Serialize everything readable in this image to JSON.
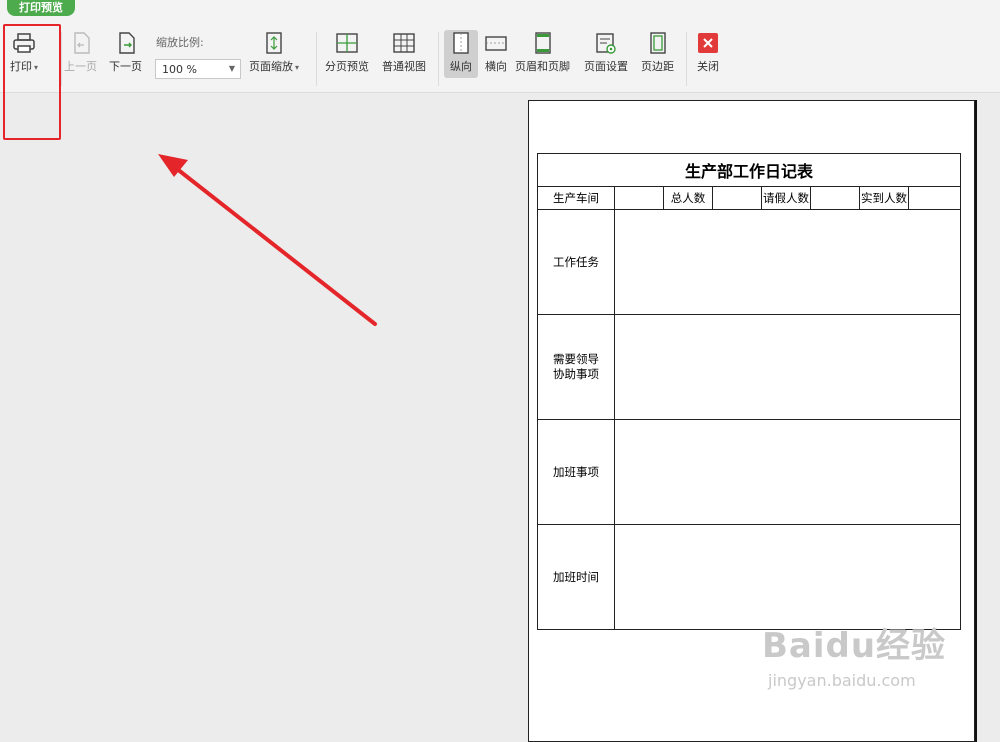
{
  "window": {
    "mode_tab": "打印预览"
  },
  "toolbar": {
    "print_label": "打印",
    "prev_label": "上一页",
    "next_label": "下一页",
    "zoom_caption": "缩放比例:",
    "zoom_value": "100 %",
    "page_zoom_label": "页面缩放",
    "page_break_preview_label": "分页预览",
    "normal_view_label": "普通视图",
    "portrait_label": "纵向",
    "landscape_label": "横向",
    "header_footer_label": "页眉和页脚",
    "page_setup_label": "页面设置",
    "margins_label": "页边距",
    "close_label": "关闭",
    "colors": {
      "accent_green": "#4daa4d",
      "close_red": "#e23a3a",
      "annotation_red": "#e4262a"
    }
  },
  "sheet": {
    "title": "生产部工作日记表",
    "header": {
      "workshop": "生产车间",
      "total": "总人数",
      "leave": "请假人数",
      "present": "实到人数"
    },
    "rows": [
      {
        "label_line1": "工作任务",
        "label_line2": ""
      },
      {
        "label_line1": "需要领导",
        "label_line2": "协助事项"
      },
      {
        "label_line1": "加班事项",
        "label_line2": ""
      },
      {
        "label_line1": "加班时间",
        "label_line2": ""
      }
    ]
  },
  "watermark": {
    "main": "Baidu经验",
    "sub": "jingyan.baidu.com"
  }
}
